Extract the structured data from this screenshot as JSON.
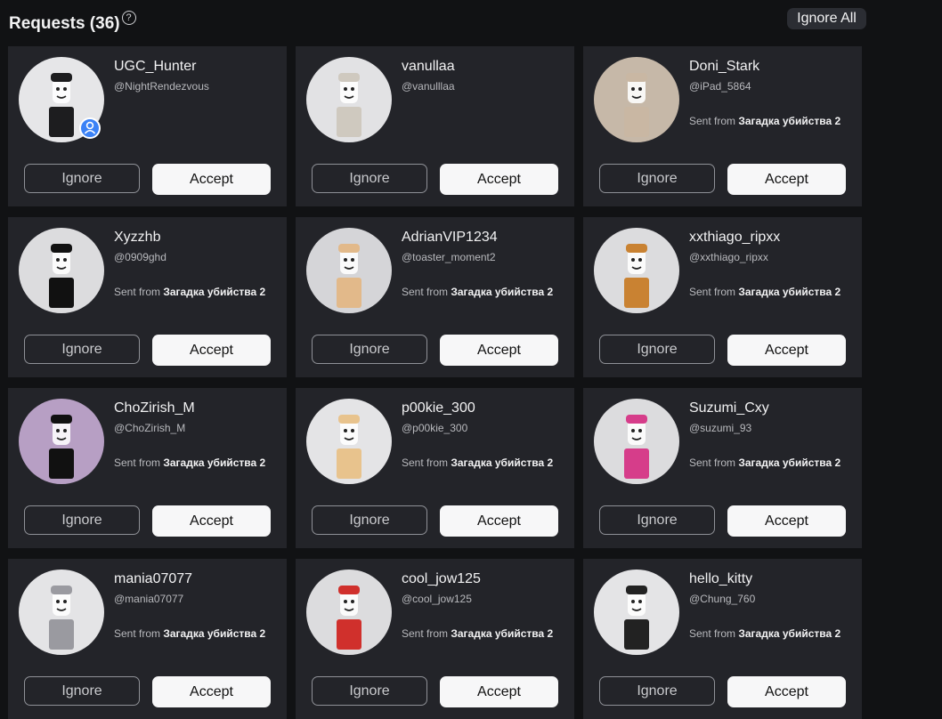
{
  "header": {
    "title": "Requests (36)",
    "help_glyph": "?",
    "ignore_all_label": "Ignore All"
  },
  "buttons": {
    "ignore": "Ignore",
    "accept": "Accept"
  },
  "sent_prefix": "Sent from ",
  "requests": [
    {
      "name": "UGC_Hunter",
      "handle": "@NightRendezvous",
      "sent_from": "",
      "verified": true,
      "avatar": "graffiti-cap-avatar",
      "bg": "#e6e6e8",
      "accent": "#1d1d1f"
    },
    {
      "name": "vanullaa",
      "handle": "@vanulllaa",
      "sent_from": "",
      "verified": false,
      "avatar": "deer-mask-avatar",
      "bg": "#e2e2e4",
      "accent": "#cfc9bf"
    },
    {
      "name": "Doni_Stark",
      "handle": "@iPad_5864",
      "sent_from": "Загадка убийства 2",
      "verified": false,
      "avatar": "classic-face-avatar",
      "bg": "#c6b8a8",
      "accent": "#c9b7a3"
    },
    {
      "name": "Xyzzhb",
      "handle": "@0909ghd",
      "sent_from": "Загадка убийства 2",
      "verified": false,
      "avatar": "black-suit-avatar",
      "bg": "#dcdcde",
      "accent": "#111111"
    },
    {
      "name": "AdrianVIP1234",
      "handle": "@toaster_moment2",
      "sent_from": "Загадка убийства 2",
      "verified": false,
      "avatar": "blond-man-avatar",
      "bg": "#d5d5d8",
      "accent": "#e2b98a"
    },
    {
      "name": "xxthiago_ripxx",
      "handle": "@xxthiago_ripxx",
      "sent_from": "Загадка убийства 2",
      "verified": false,
      "avatar": "orange-hair-avatar",
      "bg": "#dcdcde",
      "accent": "#c98232"
    },
    {
      "name": "ChoZirish_M",
      "handle": "@ChoZirish_M",
      "sent_from": "Загадка убийства 2",
      "verified": false,
      "avatar": "dark-face-avatar",
      "bg": "#b79fc4",
      "accent": "#111111"
    },
    {
      "name": "p00kie_300",
      "handle": "@p00kie_300",
      "sent_from": "Загадка убийства 2",
      "verified": false,
      "avatar": "small-girl-avatar",
      "bg": "#e4e4e6",
      "accent": "#e8c38d"
    },
    {
      "name": "Suzumi_Cxy",
      "handle": "@suzumi_93",
      "sent_from": "Загадка убийства 2",
      "verified": false,
      "avatar": "pink-hair-avatar",
      "bg": "#dcdcde",
      "accent": "#d63d8a"
    },
    {
      "name": "mania07077",
      "handle": "@mania07077",
      "sent_from": "Загадка убийства 2",
      "verified": false,
      "avatar": "flower-girl-avatar",
      "bg": "#e4e4e6",
      "accent": "#9a9aa0"
    },
    {
      "name": "cool_jow125",
      "handle": "@cool_jow125",
      "sent_from": "Загадка убийства 2",
      "verified": false,
      "avatar": "red-cap-avatar",
      "bg": "#dcdcde",
      "accent": "#d0302c"
    },
    {
      "name": "hello_kitty",
      "handle": "@Chung_760",
      "sent_from": "Загадка убийства 2",
      "verified": false,
      "avatar": "headphones-avatar",
      "bg": "#e4e4e6",
      "accent": "#222222"
    }
  ]
}
